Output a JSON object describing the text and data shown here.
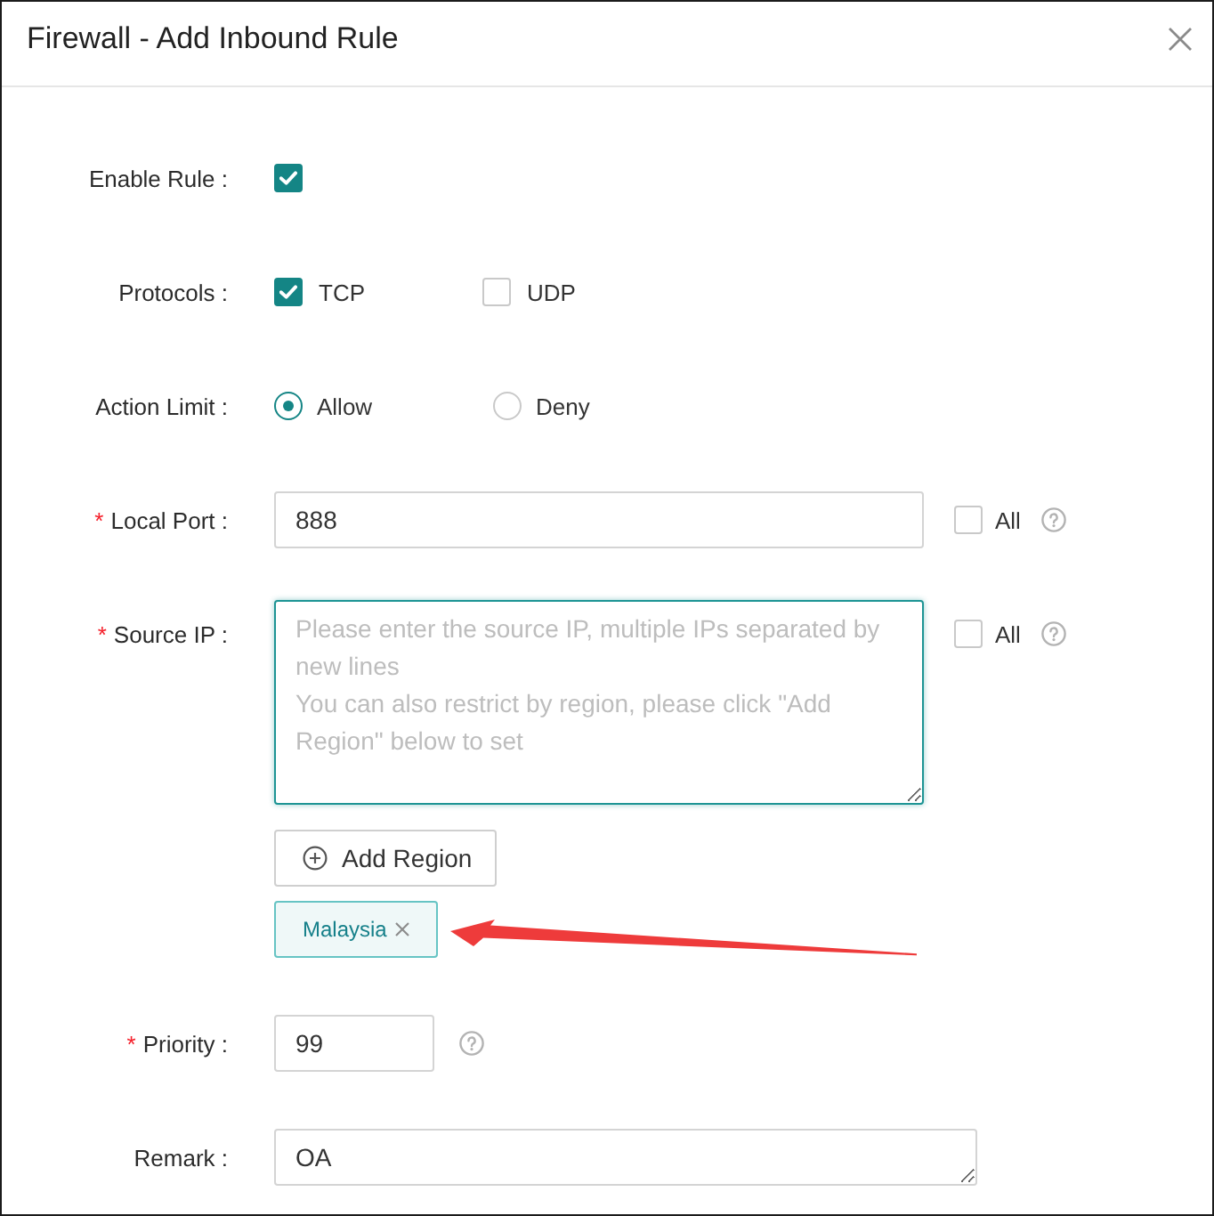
{
  "window": {
    "title": "Firewall - Add Inbound Rule"
  },
  "form": {
    "fields": [
      {
        "kind": "checkbox",
        "label": "Enable Rule :",
        "checked": true
      },
      {
        "kind": "checkbox_group",
        "label": "Protocols :",
        "options": [
          {
            "label": "TCP",
            "checked": true
          },
          {
            "label": "UDP",
            "checked": false
          }
        ]
      },
      {
        "kind": "radio_group",
        "label": "Action Limit :",
        "options": [
          {
            "label": "Allow",
            "selected": true
          },
          {
            "label": "Deny",
            "selected": false
          }
        ]
      },
      {
        "kind": "text_input",
        "required_mark": "*",
        "label": "Local Port :",
        "value": "888",
        "focused": false,
        "all_option": {
          "label": "All",
          "checked": false
        },
        "help": true
      },
      {
        "kind": "multiline_input",
        "required_mark": "*",
        "label": "Source IP :",
        "placeholder": "Please enter the source IP, multiple IPs separated by new lines\nYou can also restrict by region, please click \"Add Region\" below to set",
        "focused": true,
        "all_option": {
          "label": "All",
          "checked": false
        },
        "help": true,
        "add_button": {
          "label": "Add Region"
        },
        "tags": [
          {
            "label": "Malaysia"
          }
        ]
      },
      {
        "kind": "number_input",
        "required_mark": "*",
        "label": "Priority :",
        "value": "99",
        "focused": false,
        "help": true
      },
      {
        "kind": "note_input",
        "label": "Remark :",
        "value": "OA",
        "focused": false
      }
    ]
  }
}
